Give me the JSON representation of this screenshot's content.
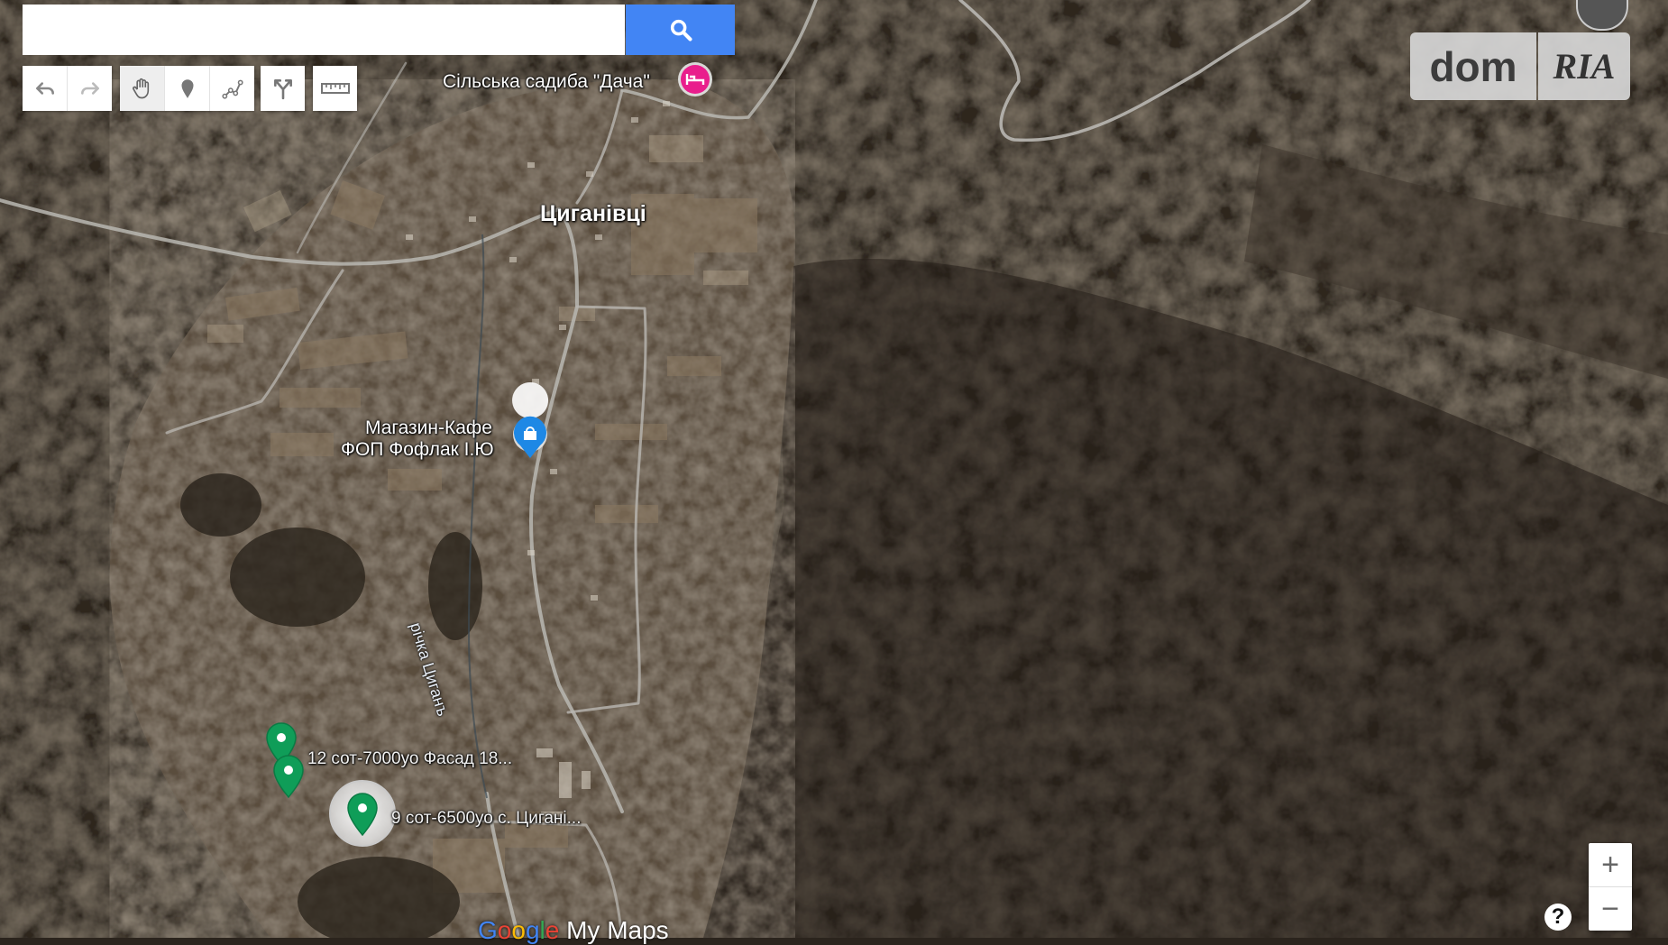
{
  "search": {
    "value": "",
    "placeholder": ""
  },
  "toolbar": {
    "undo_icon": "undo-icon",
    "redo_icon": "redo-icon",
    "pan_icon": "hand-icon",
    "marker_icon": "marker-icon",
    "line_icon": "draw-line-icon",
    "directions_icon": "directions-icon",
    "measure_icon": "ruler-icon"
  },
  "logo": {
    "dom": "dom",
    "ria": "RIA"
  },
  "places": {
    "guesthouse": "Сільська садиба \"Дача\"",
    "village": "Циганівці",
    "shop_line1": "Магазин-Кафе",
    "shop_line2": "ФОП Фофлак І.Ю",
    "river": "річка Циганъ",
    "plot1": "12 сот-7000уо Фасад 18...",
    "plot2": "9 сот-6500уо с. Цигані..."
  },
  "zoom": {
    "in": "+",
    "out": "−"
  },
  "help": "?",
  "attribution": {
    "brand": "Google",
    "product": "My Maps"
  },
  "colors": {
    "search_button": "#4285f4",
    "marker": "#0f9d58",
    "hotel_poi": "#e91e8c",
    "shop_poi": "#1e88e5"
  }
}
